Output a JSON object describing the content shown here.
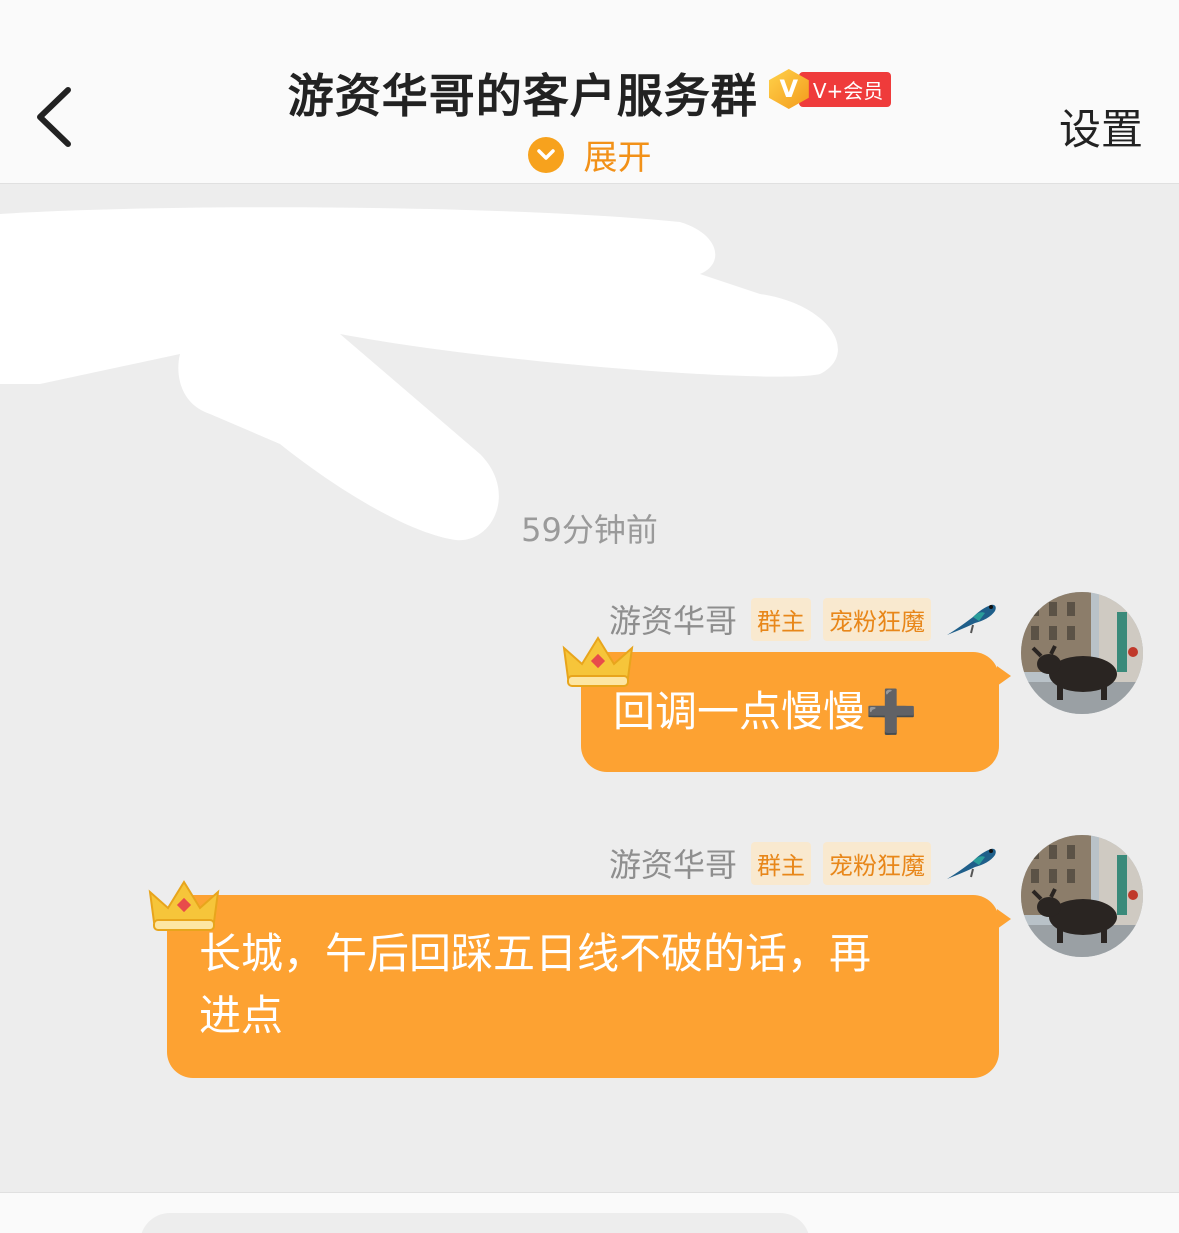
{
  "header": {
    "title": "游资华哥的客户服务群",
    "vip_v": "V",
    "vip_label": "V+会员",
    "expand_label": "展开",
    "settings_label": "设置"
  },
  "chat": {
    "timestamp": "59分钟前",
    "messages": [
      {
        "sender": "游资华哥",
        "badge_role": "群主",
        "badge_title": "宠粉狂魔",
        "text": "回调一点慢慢➕"
      },
      {
        "sender": "游资华哥",
        "badge_role": "群主",
        "badge_title": "宠粉狂魔",
        "text_line1": "长城，午后回踩五日线不破的话，再",
        "text_line2": "进点"
      }
    ]
  },
  "colors": {
    "accent": "#fda232",
    "badge_text": "#e8871a",
    "vip_red": "#ef3b3b"
  },
  "icons": [
    "back-chevron-icon",
    "chevron-down-icon",
    "crown-icon",
    "bird-icon",
    "bull-avatar"
  ]
}
